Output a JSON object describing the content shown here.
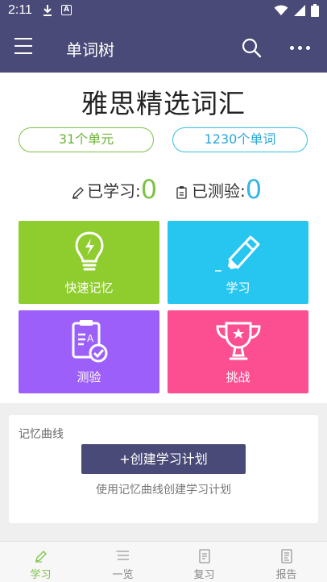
{
  "status_bar": {
    "time": "2:11",
    "notification_letter": "A"
  },
  "app_bar": {
    "title": "单词树",
    "menu_icon": "hamburger-menu-icon",
    "search_icon": "search-icon",
    "more_icon": "more-dots-icon"
  },
  "book": {
    "title": "雅思精选词汇",
    "units_label": "31个单元",
    "words_label": "1230个单词"
  },
  "stats": {
    "learned_label": "已学习",
    "learned_value": "0",
    "tested_label": "已测验",
    "tested_value": "0",
    "colon": ":"
  },
  "tiles": [
    {
      "label": "快速记忆",
      "icon": "lightbulb-icon",
      "color": "#8fcd2f"
    },
    {
      "label": "学习",
      "icon": "highlighter-icon",
      "color": "#27c6f1"
    },
    {
      "label": "测验",
      "icon": "test-paper-icon",
      "color": "#9d5ffa"
    },
    {
      "label": "挑战",
      "icon": "trophy-icon",
      "color": "#fb4f92"
    }
  ],
  "memory_curve": {
    "title": "记忆曲线",
    "button_label": "+创建学习计划",
    "hint": "使用记忆曲线创建学习计划"
  },
  "bottom_nav": [
    {
      "label": "学习",
      "icon": "pencil-icon",
      "active": true
    },
    {
      "label": "一览",
      "icon": "list-icon",
      "active": false
    },
    {
      "label": "复习",
      "icon": "document-icon",
      "active": false
    },
    {
      "label": "报告",
      "icon": "report-icon",
      "active": false
    }
  ],
  "colors": {
    "primary": "#4a4a78",
    "green": "#7cc243",
    "blue": "#35b6e6"
  }
}
